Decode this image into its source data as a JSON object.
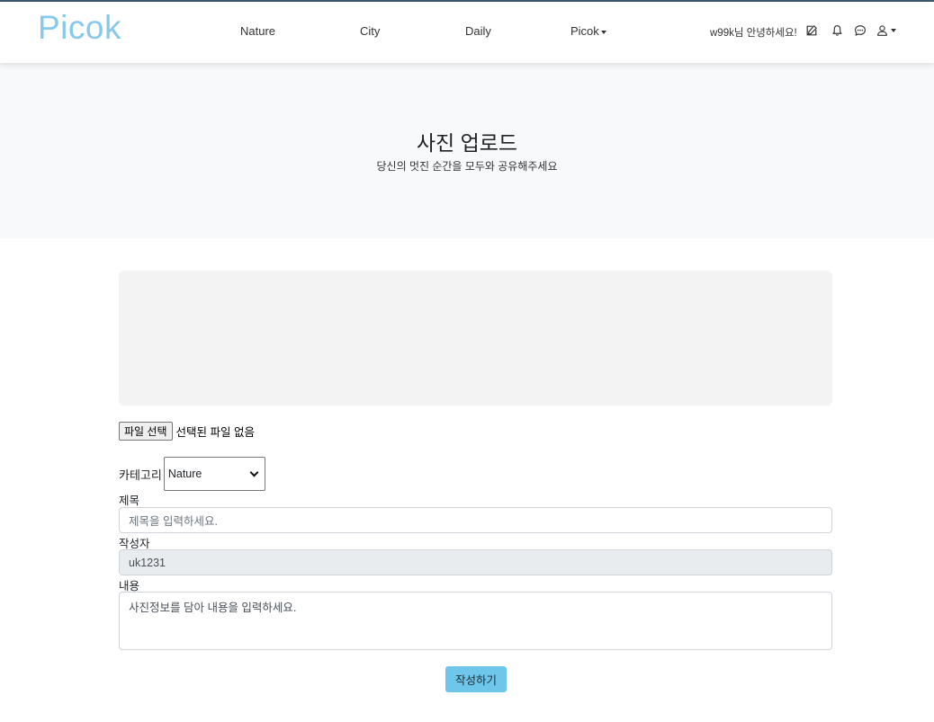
{
  "nav": {
    "brand": "Picok",
    "links": [
      {
        "label": "Nature"
      },
      {
        "label": "City"
      },
      {
        "label": "Daily"
      },
      {
        "label": "Picok"
      }
    ],
    "greeting": "w99k님 안녕하세요!",
    "icons": [
      "edit-icon",
      "bell-icon",
      "chat-icon",
      "user-icon"
    ]
  },
  "hero": {
    "title": "사진 업로드",
    "subtitle": "당신의 멋진 순간을 모두와 공유해주세요"
  },
  "form": {
    "file_button": "파일 선택",
    "file_status": "선택된 파일 없음",
    "category_label": "카테고리",
    "category_value": "Nature",
    "title_label": "제목",
    "title_placeholder": "제목을 입력하세요.",
    "author_label": "작성자",
    "author_value": "uk1231",
    "content_label": "내용",
    "content_placeholder": "사진정보를 담아 내용을 입력하세요.",
    "submit_label": "작성하기"
  },
  "colors": {
    "brand": "#87c9ec",
    "submit": "#6ec6eb",
    "hero_bg": "#f8f9fa",
    "preview_bg": "#f3f3f3"
  }
}
